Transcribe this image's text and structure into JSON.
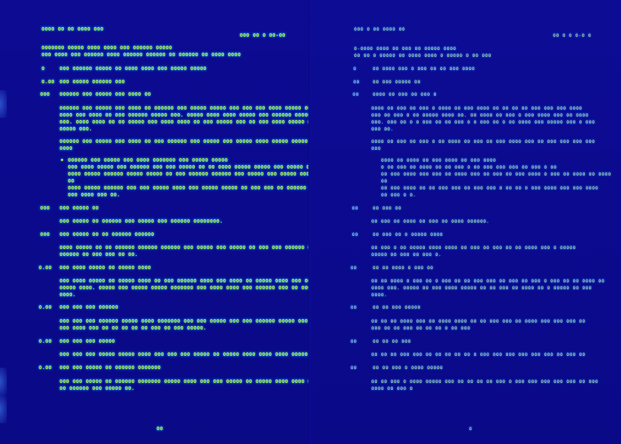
{
  "left_page": {
    "running_header": "OOOO OO OO OOOO OOO",
    "section_header": "OOO OO O OO-OO",
    "intro": [
      "OOOOOOO OOOOO OOOO OOOO OOO OOOOOO OOOOO",
      "OOO OOOO OOO OOOOOO OOOO OOOOOO OOOOOO OO OOOOOO OO OOOO OOOO"
    ],
    "heading_main": {
      "num": "O",
      "text": "OOO OOOOOO OOOOO OO OOOO OOOO OOO OOOOO OOOOO"
    },
    "sub_1_1": {
      "num": "O.OO",
      "text": "OOO OOOOO OOOOOO OOO"
    },
    "sub_1_1_1": {
      "num": "OOO",
      "text": "OOOOOO OOO OOOOO OOO OOOO OO"
    },
    "para_1": [
      "OOOOOO OOO OOOOO OOO OOOO OO OOOOOO OOO OOOOO OOOOO OOO OOO OOO OOOO OOOOO OOOOO OOOOO",
      "OOOO OOO OOOO OO OOO OOOOOO OOOOO OOO. OOOOO OOOO OOOO OOOOO OOO OOOOOO OOOOO OOO OOOOO OOOO",
      "OOO. OOOO OOOO OO OO OOOOO OOO OOOO OOOO OO OOO OOOOO OOO OO OOO OOOO OOOOO OOOO OO OOOOO",
      "OOOOO OOO."
    ],
    "para_2": [
      "OOOOOO OOO OOOOO OOO OOOO OO OOO OOOOOO OOO OOOOO OOO OOOOO OOOO OOOOO OOOOO OOO OOOO OOOOO",
      "OOOO"
    ],
    "bullets": [
      "OOOOOO OOO OOOOO OOO OOOO OOOOOOO OOO OOOOO OOOOO",
      "OOO OOOO OOOOO OOO OOOOOO OOO OOO OOOOO OO OO OOOO OOOOO OOOOO OOO OOOOO OO OOO",
      "OOOO OOOOO OOOOOO OOOOO OOOOO OO OOO OOOOOO OOOOOO OOO OOOOO OOO OOOOO OOO OOO OOO OOOOO",
      "OO",
      "OOOO OOOOO OOOOOO OOO OOO OOOOO OOOO OOO OOOOO OOOOO OO OOO OOO OO OOOOOO OOOOO OOOOO",
      "OOO OOOO OOO OO."
    ],
    "sub_1_1_2": {
      "num": "OOO",
      "text": "OOO OOOOO OO"
    },
    "para_3": "OOO OOOOO OO OOOOOO OOO OOOOO OOO OOOOOO OOOOOOOO.",
    "sub_1_1_3": {
      "num": "OOO",
      "text": "OOO OOOOO OO OO OOOOOO OOOOOO"
    },
    "para_4": [
      "OOOO OOOOO OO OO OOOOOO OOOOOO OOOOOO OOO OOOOO OOO OOOOO OO OOO OOO OOOOOO OOOOO OO OOOOOOO",
      "OOOOOO OO OOO OOO OO OO."
    ],
    "sub_1_2": {
      "num": "O.OO",
      "text": "OOO OOOO OOOOO OO OOOOO OOOO"
    },
    "para_5": [
      "OOO OOOO OOOOO OO OOOOO OOOO OO OOO OOOOOO OOOO OOO OOOO OO OOOOO OOOO OOO OOOOOOO OOOOO",
      "OOOOO OOOO. OOOOO OOO OOOOO OOOOO OOOOOOO OOO OOOO OOOO OOO OOOOOO OOO OO OOOOOO OOO OOOO",
      "OOOO."
    ],
    "sub_1_3": {
      "num": "O.OO",
      "text": "OOO OOO OOO OOOOOO"
    },
    "para_6": [
      "OOO OOO OOO OOOOOO OOOOO OOOO OOOOOOO OOO OOO OOOOO OOO OOO OOOOOO OOOOO OOO OOOO OOOO",
      "OOO OOOO OOO OO OO OO OO OO OOO OO OOO OOOOO."
    ],
    "sub_1_4": {
      "num": "O.OO",
      "text": "OOO OOO OOO OOOOO"
    },
    "para_7": "OOO OOO OOO OOOOO OOOOO OOOO OOO OOO OOO OOOOO OO OOOOO OOOO OOOO OOOO OOOOO OOOO OOOOO OO",
    "sub_1_5": {
      "num": "O.OO",
      "text": "OOO OOO OOOOO OO OOOOOO OOOOOOO"
    },
    "para_8": [
      "OOO OOO OOOOO OO OOOOOO OOOOOOO OOOOO OOOO OOO OOO OOOOO OO OOOOO OOOO OOOO OOOO OOO OOOO OOOO",
      "OO OOOOOO OOO OOOOO OO."
    ],
    "page_number": "OO"
  },
  "right_page": {
    "running_header": "OOO O OO OOOO OO",
    "section_header": "OO O O O-O O",
    "intro": [
      "O-OOOO OOOO OO OOO OO OOOOO OOOO",
      "OO OO O OOOOO OO OOOO OOOO O OOOOO O OO OOO"
    ],
    "heading_main": {
      "num": "O",
      "text": "OO OOOO OOO O OOO OO OO OOO OOOO"
    },
    "sub_1_1": {
      "num": "OO",
      "text": "OO OOO OOOOO OO"
    },
    "sub_1_1_1": {
      "num": "OO",
      "text": "OOOO OO OOO OO OOO O"
    },
    "para_1": [
      "OOOO OO OOO OO OOO O OOOO OO OOO OOOO OO OO OO OO OOO OOO OOO OOOO",
      "OOO OO OOO O OO OOOOO OOOO OO. OO OOOO OO OOO O OOO OOOO OOO OO OOOO",
      "OOO. OOO OO O O OOO OO OO OOO O O OOO OO O OO OOOO OOO OOOOO OOO O OOO",
      "OOO OO."
    ],
    "para_2": [
      "OOOO OO OOO OO OOO O OO OOOO OO OOO OO OOO OOOO OOO OO OOO OOO OOO OOO",
      "OOO"
    ],
    "bullets": [
      "OOOO OO OOOO OO OOO OOOO OO OOO OOOO",
      "O OO OOO OO OOOO OO OO OOO O OO OOO OOO OOO OO OOO O OO",
      "OO OOO OOOO OOO OOO OO OOOO OOO OO OOO OO OOO OOOO O OOO OO OOOO OO OOOO",
      "OO",
      "OO OOO OOOO OO OO OOO OOO OO OOO OOO O OO OO O OOO OOOO OOO OOO OOOO",
      "OO OOO O O."
    ],
    "sub_1_1_2": {
      "num": "OO",
      "text": "OO OOO OO"
    },
    "para_3": "OO OOO OO OOOO OO OOO OO OOOO OOOOOO.",
    "sub_1_1_3": {
      "num": "OO",
      "text": "OO OOO OO O OOOOO OOOO"
    },
    "para_4": [
      "OO OOO O OO OOOOO OOOO OOOO OO OOO OO OOO OO OO OOOO OOO O OOOOO",
      "OOOOO OO OOO OO OOO O."
    ],
    "sub_1_2": {
      "num": "OO",
      "text": "OO OO OOOO O OOO OO"
    },
    "para_5": [
      "OO OO OOOO O OOO OO O OOO OO OO OOO OOO OO OOO OO OOO O OOO OO OO OOOO OO",
      "OOOO OOO. OOOOO OO OOO OOOO OOOOO OO OO OOO OO OOOO OO O OOOOO OO OOO",
      "OOOO."
    ],
    "sub_1_3": {
      "num": "OO",
      "text": "OO OO OOO OOOOO"
    },
    "para_6": [
      "OO OO OO OOOO OOO OO OOOO OOOO OO OO OOO OOO OO OOOO OOO OOO OOO OO",
      "OOO OO OO OOO OO OO OO O OO OOO"
    ],
    "sub_1_4": {
      "num": "OO",
      "text": "OO OO OO OOO"
    },
    "para_7": "OO OO OO OOO OOO OO OO OO OO OO O OOO OOO OOO OOO OOO OOO OO OOO OO",
    "sub_1_5": {
      "num": "OO",
      "text": "OO OO OOO O OOOO OOOOO"
    },
    "para_8": [
      "OO OO OOO O OOOO OOOOO OOO OO OO OO OO OOO O OOO OOO OOO OOO OOO OO OOO",
      "OOOO OO OOO O"
    ],
    "page_number": "O"
  },
  "colors": {
    "background": "#0b0a8c",
    "text_glow": "#c8ff3a",
    "halo": "#1fd2ff"
  }
}
